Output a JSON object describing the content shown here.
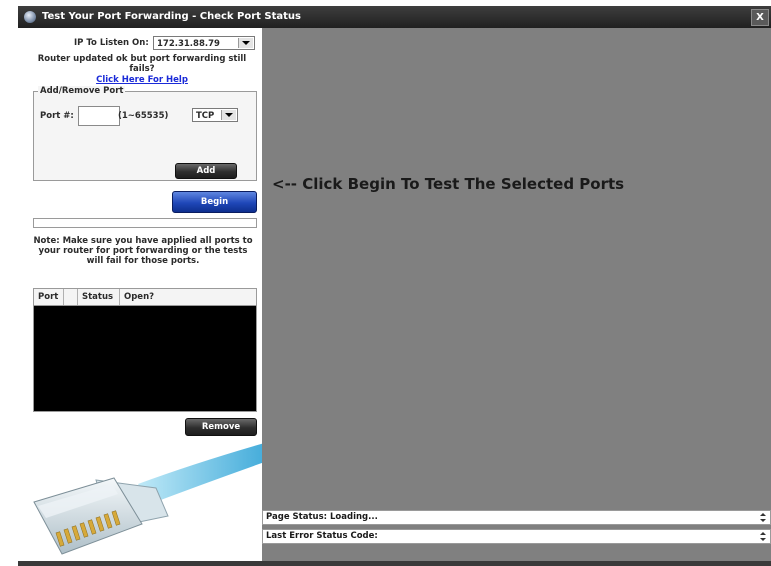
{
  "window": {
    "title": "Test Your Port Forwarding - Check Port Status",
    "close_label": "X"
  },
  "ip": {
    "label": "IP To Listen On:",
    "selected": "172.31.88.79"
  },
  "router_text": "Router updated ok but port forwarding still fails?",
  "help_link": "Click Here For Help",
  "add_remove": {
    "legend": "Add/Remove Port",
    "port_label": "Port #:",
    "port_value": "",
    "range": "(1~65535)",
    "protocol": "TCP",
    "add_label": "Add"
  },
  "begin_label": "Begin",
  "progress": 0,
  "note": "Note: Make sure you have applied all ports to your router for port forwarding or the tests will fail for those ports.",
  "table": {
    "columns": [
      "Port",
      "Status",
      "Open?"
    ],
    "rows": []
  },
  "remove_label": "Remove",
  "hint": "<-- Click Begin To Test The Selected Ports",
  "status": {
    "page_status": "Page Status: Loading...",
    "last_error": "Last Error Status Code:"
  }
}
